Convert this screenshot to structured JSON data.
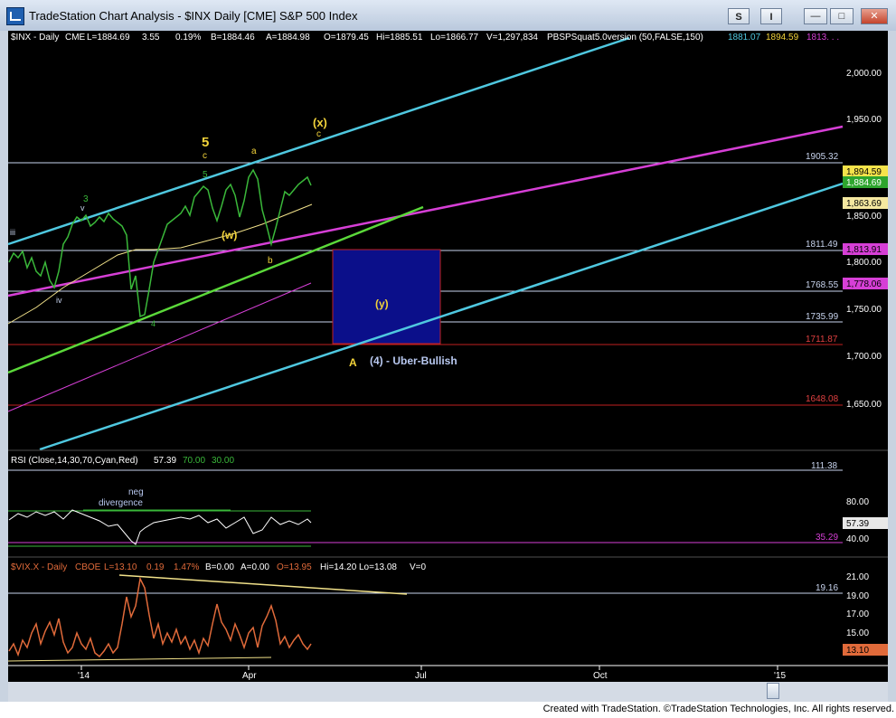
{
  "window": {
    "title": "TradeStation Chart Analysis - $INX Daily [CME] S&P 500 Index",
    "buttons": {
      "s": "S",
      "i": "I",
      "minimize": "—",
      "restore": "□",
      "close": "✕"
    },
    "icon": "tradestation-app-icon"
  },
  "price_pane": {
    "header": {
      "symbol": "$INX - Daily",
      "exchange": "CME",
      "last": "L=1884.69",
      "change": "3.55",
      "pct": "0.19%",
      "bid": "B=1884.46",
      "ask": "A=1884.98",
      "open": "O=1879.45",
      "high": "Hi=1885.51",
      "low": "Lo=1866.77",
      "volume": "V=1,297,834",
      "study": "PBSPSquat5.0version (50,FALSE,150)",
      "study_v1": "1881.07",
      "study_v2": "1894.59",
      "study_v3": "1813. . ."
    },
    "axis_ticks": [
      "2,000.00",
      "1,950.00",
      "1,900.00",
      "1,850.00",
      "1,800.00",
      "1,750.00",
      "1,700.00",
      "1,650.00"
    ],
    "level_labels": {
      "l1905": "1905.32",
      "l1811": "1811.49",
      "l1768": "1768.55",
      "l1735": "1735.99",
      "l1711": "1711.87",
      "l1648": "1648.08"
    },
    "axis_tags": {
      "t1894": "1,894.59",
      "t1884": "1,884.69",
      "t1863": "1,863.69",
      "t1813": "1,813.91",
      "t1778": "1,778.06"
    },
    "annotations": {
      "five_big": "5",
      "c_gold": "c",
      "five_green": "5",
      "a_label": "a",
      "x_label": "(x)",
      "c_small": "c",
      "three": "3",
      "v": "v",
      "iii": "iii",
      "iv": "iv",
      "w_label": "(w)",
      "b_label": "b",
      "four_small": "4",
      "y_label": "(y)",
      "A_label": "A",
      "uber": "(4) - Uber-Bullish"
    }
  },
  "rsi_pane": {
    "header": {
      "title": "RSI (Close,14,30,70,Cyan,Red)",
      "value": "57.39",
      "ob": "70.00",
      "os": "30.00"
    },
    "top_label": "111.38",
    "ticks": [
      "80.00",
      "40.00"
    ],
    "value_tag": "57.39",
    "level_label": "35.29",
    "note1": "neg",
    "note2": "divergence"
  },
  "vix_pane": {
    "header": {
      "symbol": "$VIX.X - Daily",
      "exchange": "CBOE",
      "last": "L=13.10",
      "change": "0.19",
      "pct": "1.47%",
      "bid": "B=0.00",
      "ask": "A=0.00",
      "open": "O=13.95",
      "high": "Hi=14.20",
      "low": "Lo=13.08",
      "volume": "V=0"
    },
    "ticks": [
      "21.00",
      "19.00",
      "17.00",
      "15.00"
    ],
    "level_label": "19.16",
    "value_tag": "13.10"
  },
  "x_axis": [
    "'14",
    "Apr",
    "Jul",
    "Oct",
    "'15"
  ],
  "footer": {
    "credit": "Created with TradeStation. ©TradeStation Technologies, Inc. All rights reserved."
  },
  "colors": {
    "background": "#000000",
    "price_bars": "#3ab83a",
    "channel": "#4fc8e0",
    "magenta": "#d63fd6",
    "rsi_line": "#ffffff",
    "vix_bars": "#e06a3a",
    "target_box": "#0b0f8a",
    "level_red": "#c02020",
    "wave_gold": "#f2d33a"
  }
}
